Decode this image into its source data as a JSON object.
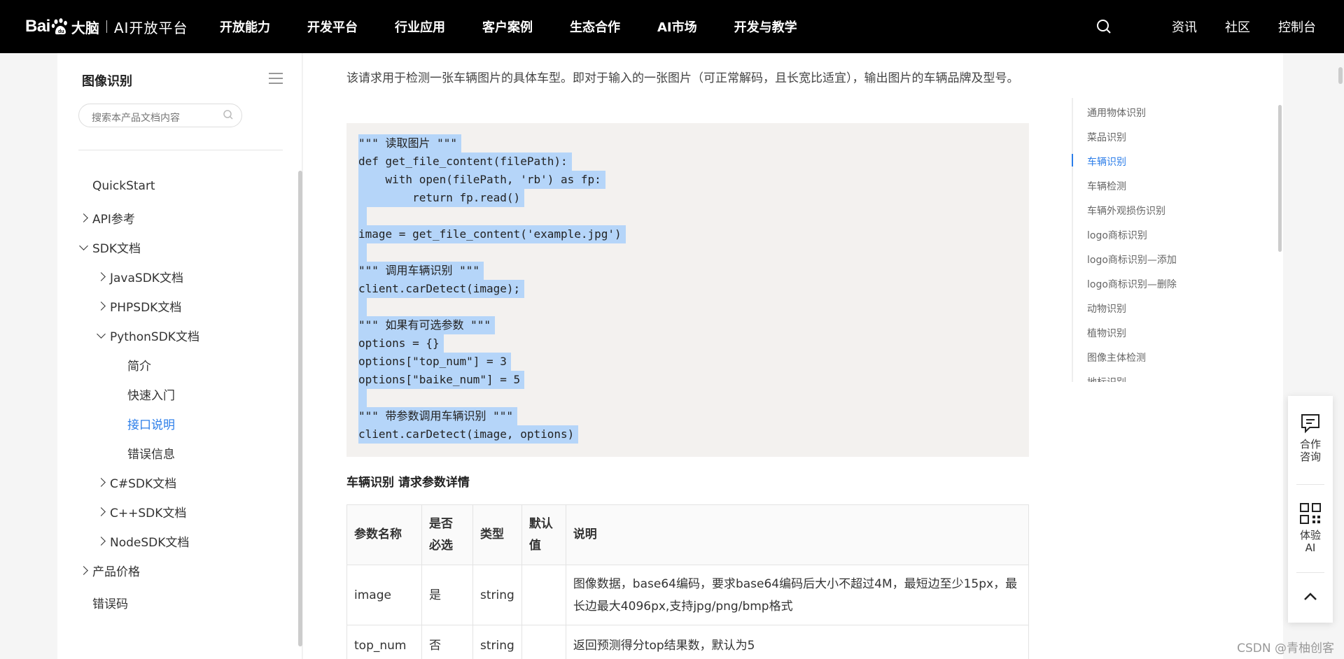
{
  "header": {
    "logo_text": "Bai",
    "logo_brain": "大脑",
    "logo_platform": "AI开放平台",
    "nav": [
      "开放能力",
      "开发平台",
      "行业应用",
      "客户案例",
      "生态合作",
      "AI市场",
      "开发与教学"
    ],
    "right_links": [
      "资讯",
      "社区",
      "控制台"
    ]
  },
  "sidebar": {
    "title": "图像识别",
    "search_placeholder": "搜索本产品文档内容",
    "items": [
      {
        "label": "QuickStart"
      },
      {
        "label": "API参考"
      },
      {
        "label": "SDK文档"
      },
      {
        "label": "JavaSDK文档"
      },
      {
        "label": "PHPSDK文档"
      },
      {
        "label": "PythonSDK文档"
      },
      {
        "label": "简介"
      },
      {
        "label": "快速入门"
      },
      {
        "label": "接口说明"
      },
      {
        "label": "错误信息"
      },
      {
        "label": "C#SDK文档"
      },
      {
        "label": "C++SDK文档"
      },
      {
        "label": "NodeSDK文档"
      },
      {
        "label": "产品价格"
      },
      {
        "label": "错误码"
      }
    ]
  },
  "main": {
    "intro": "该请求用于检测一张车辆图片的具体车型。即对于输入的一张图片（可正常解码，且长宽比适宜），输出图片的车辆品牌及型号。",
    "code_lines": [
      "\"\"\" 读取图片 \"\"\"",
      "def get_file_content(filePath):",
      "    with open(filePath, 'rb') as fp:",
      "        return fp.read()",
      "",
      "image = get_file_content('example.jpg')",
      "",
      "\"\"\" 调用车辆识别 \"\"\"",
      "client.carDetect(image);",
      "",
      "\"\"\" 如果有可选参数 \"\"\"",
      "options = {}",
      "options[\"top_num\"] = 3",
      "options[\"baike_num\"] = 5",
      "",
      "\"\"\" 带参数调用车辆识别 \"\"\"",
      "client.carDetect(image, options)"
    ],
    "section_title": "车辆识别 请求参数详情",
    "table": {
      "headers": [
        "参数名称",
        "是否必选",
        "类型",
        "默认值",
        "说明"
      ],
      "header_lines": [
        [
          "参数名称"
        ],
        [
          "是否",
          "必选"
        ],
        [
          "类型"
        ],
        [
          "默认",
          "值"
        ],
        [
          "说明"
        ]
      ],
      "rows": [
        {
          "name": "image",
          "required": "是",
          "type": "string",
          "default": "",
          "desc": "图像数据，base64编码，要求base64编码后大小不超过4M，最短边至少15px，最长边最大4096px,支持jpg/png/bmp格式"
        },
        {
          "name": "top_num",
          "required": "否",
          "type": "string",
          "default": "",
          "desc": "返回预测得分top结果数，默认为5"
        }
      ]
    }
  },
  "toc": {
    "items": [
      "通用物体识别",
      "菜品识别",
      "车辆识别",
      "车辆检测",
      "车辆外观损伤识别",
      "logo商标识别",
      "logo商标识别—添加",
      "logo商标识别—删除",
      "动物识别",
      "植物识别",
      "图像主体检测",
      "地标识别"
    ],
    "active": "车辆识别"
  },
  "float_panel": {
    "consult": "合作咨询",
    "consult_lines": [
      "合作",
      "咨询"
    ],
    "try_ai_lines": [
      "体验",
      "AI"
    ]
  },
  "watermark": "CSDN @青柚创客",
  "colors": {
    "accent": "#2b7de9",
    "selection": "#b5d5f9",
    "code_bg": "#f3f1ef",
    "nav_bg": "#000000"
  }
}
